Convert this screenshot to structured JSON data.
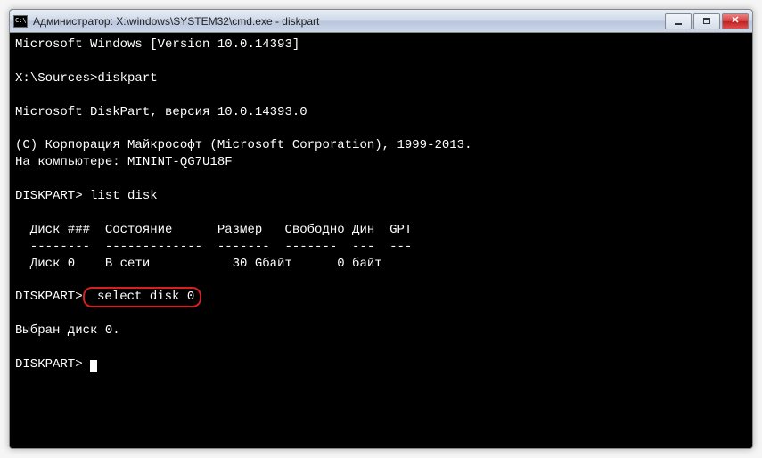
{
  "window": {
    "title": "Администратор: X:\\windows\\SYSTEM32\\cmd.exe - diskpart"
  },
  "terminal": {
    "line_01": "Microsoft Windows [Version 10.0.14393]",
    "line_02": "",
    "line_03_prompt": "X:\\Sources>",
    "line_03_cmd": "diskpart",
    "line_04": "",
    "line_05": "Microsoft DiskPart, версия 10.0.14393.0",
    "line_06": "",
    "line_07": "(C) Корпорация Майкрософт (Microsoft Corporation), 1999-2013.",
    "line_08": "На компьютере: MININT-QG7U18F",
    "line_09": "",
    "line_10_prompt": "DISKPART>",
    "line_10_cmd": " list disk",
    "line_11": "",
    "line_12": "  Диск ###  Состояние      Размер   Свободно Дин  GPT",
    "line_13": "  --------  -------------  -------  -------  ---  ---",
    "line_14": "  Диск 0    В сети           30 Gбайт      0 байт",
    "line_15": "",
    "line_16_prompt": "DISKPART>",
    "line_16_cmd": " select disk 0",
    "line_17": "",
    "line_18": "Выбран диск 0.",
    "line_19": "",
    "line_20_prompt": "DISKPART>",
    "line_20_cmd": " "
  }
}
